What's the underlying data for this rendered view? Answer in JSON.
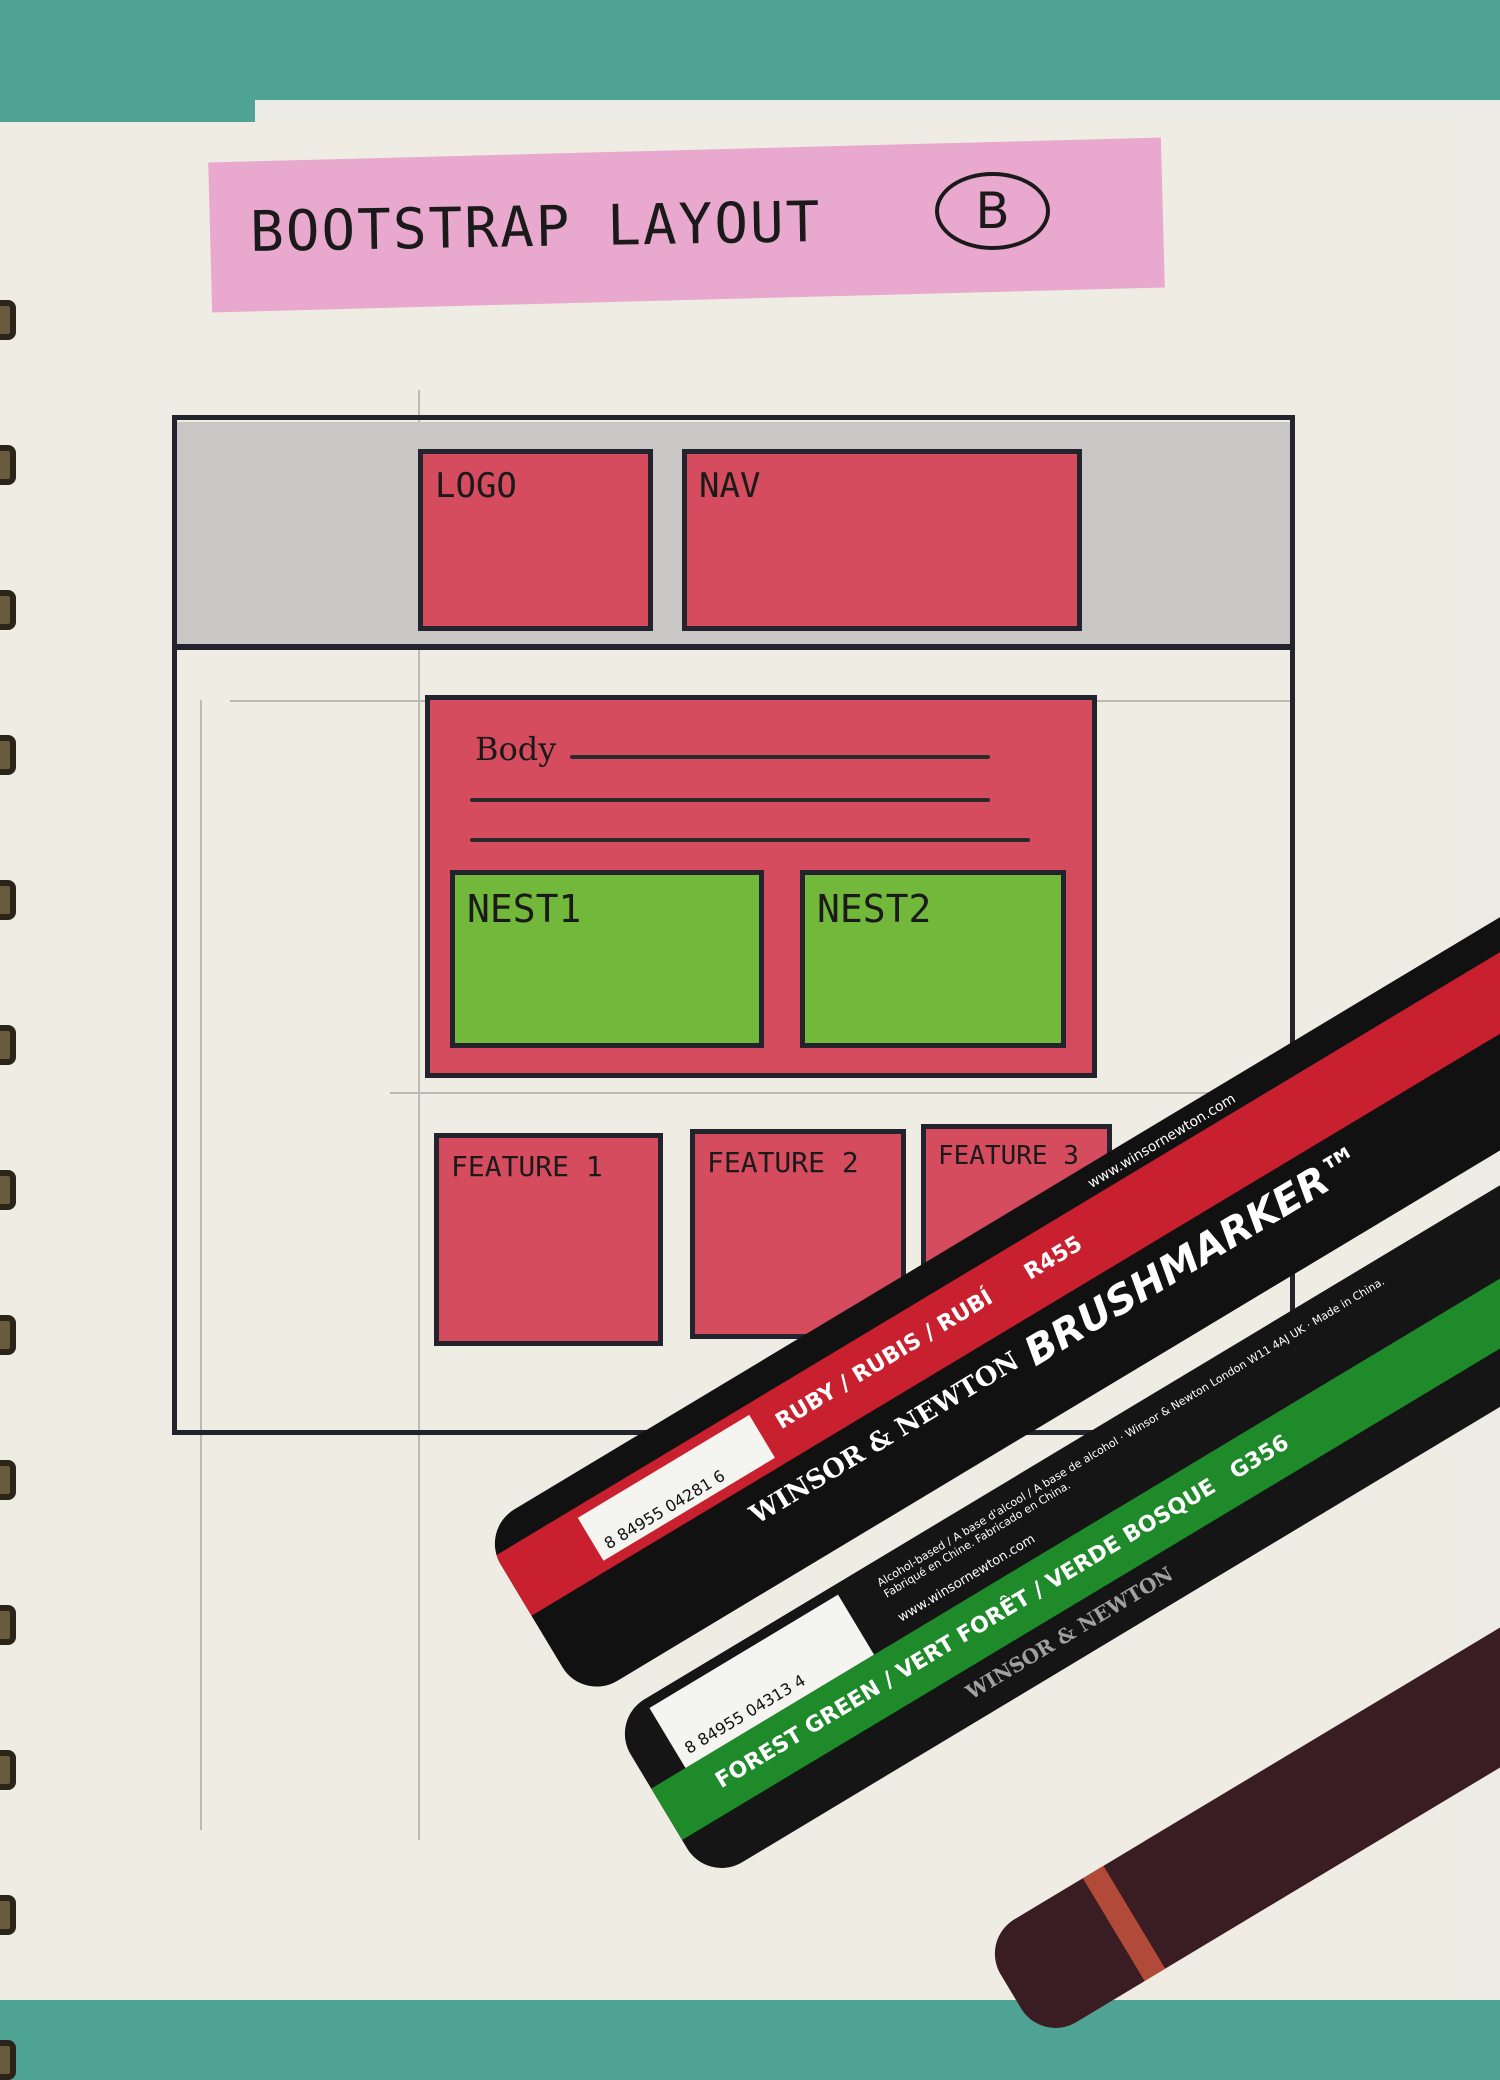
{
  "sketch": {
    "title": "BOOTSTRAP LAYOUT",
    "badge": "B",
    "header": {
      "logo": "LOGO",
      "nav": "NAV"
    },
    "body": {
      "label": "Body",
      "nests": [
        "NEST1",
        "NEST2"
      ]
    },
    "features": [
      "FEATURE 1",
      "FEATURE 2",
      "FEATURE 3"
    ]
  },
  "colors": {
    "red": "#d44c5e",
    "green": "#72b83b",
    "gray": "#c9c7c5",
    "pink": "#e9a9cf",
    "paper": "#efece4",
    "table": "#4fa394"
  },
  "markers": [
    {
      "brand": "WINSOR & NEWTON",
      "product": "BRUSHMARKER™",
      "color_name": "RUBY / RUBIS / RUBÍ",
      "code": "R455",
      "barcode": "8 84955 04281 6",
      "site": "www.winsornewton.com",
      "hex": "#c8202f"
    },
    {
      "brand": "WINSOR & NEWTON",
      "color_name": "FOREST GREEN / VERT FORÊT / VERDE BOSQUE",
      "code": "G356",
      "barcode": "8 84955 04313 4",
      "info": "Alcohol-based / A base d'alcool / A base de alcohol · Winsor & Newton London W11 4AJ UK · Made in China. Fabriqué en Chine. Fabricado en China.",
      "site": "www.winsornewton.com",
      "hex": "#1e8a2a"
    }
  ]
}
